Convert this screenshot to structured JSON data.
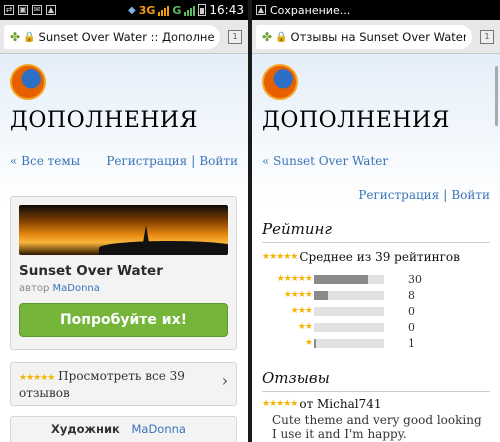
{
  "left": {
    "status_time": "16:43",
    "network_3g": "3G",
    "network_g": "G",
    "url": "Sunset Over Water :: Дополнения",
    "heading": "ДОПОЛНЕНИЯ",
    "nav_back": "« Все темы",
    "nav_register": "Регистрация",
    "nav_sep": "|",
    "nav_login": "Войти",
    "addon_title": "Sunset Over Water",
    "author_prefix": "автор",
    "author_name": "MaDonna",
    "try_button": "Попробуйте их!",
    "view_reviews": "Просмотреть все 39 отзывов",
    "artist_label": "Художник",
    "artist_name": "MaDonna"
  },
  "right": {
    "status_text": "Сохранение...",
    "url": "Отзывы на Sunset Over Water",
    "heading": "ДОПОЛНЕНИЯ",
    "nav_back": "« Sunset Over Water",
    "nav_register": "Регистрация",
    "nav_sep": "|",
    "nav_login": "Войти",
    "rating_title": "Рейтинг",
    "average": "Среднее из 39 рейтингов",
    "ratings": [
      {
        "stars": 5,
        "count": "30",
        "fraction": 0.77
      },
      {
        "stars": 4,
        "count": "8",
        "fraction": 0.2
      },
      {
        "stars": 3,
        "count": "0",
        "fraction": 0
      },
      {
        "stars": 2,
        "count": "0",
        "fraction": 0
      },
      {
        "stars": 1,
        "count": "1",
        "fraction": 0.03
      }
    ],
    "reviews_title": "Отзывы",
    "review_author": "от Michal741",
    "review_text": "Cute theme and very good looking I use it and I'm happy."
  },
  "colors": {
    "link": "#3a74b8",
    "button": "#74b53a",
    "star": "#f5b400"
  }
}
